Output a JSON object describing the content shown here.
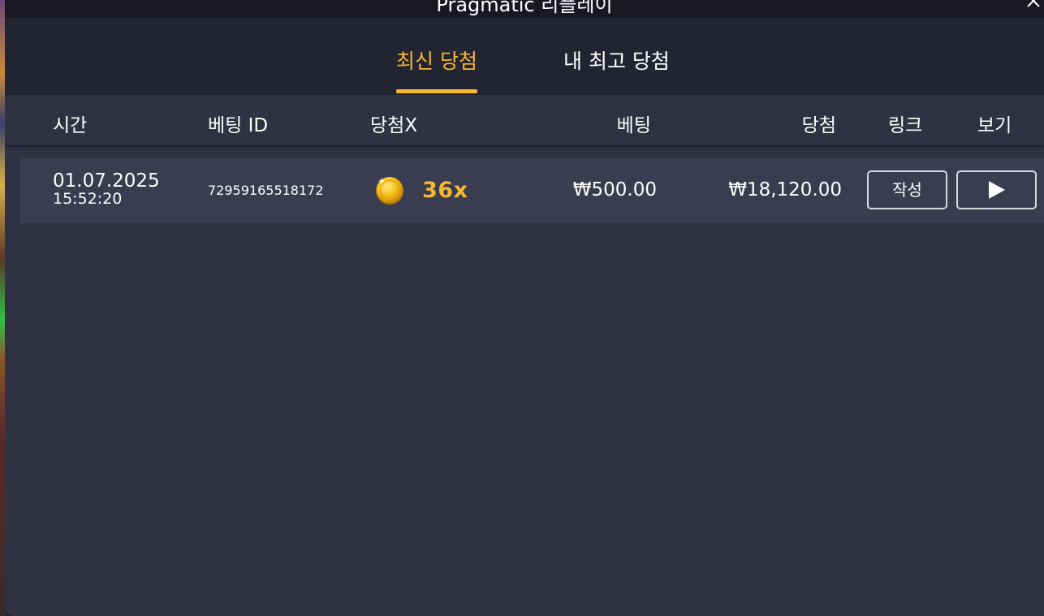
{
  "window": {
    "title": "Pragmatic 리플레이"
  },
  "tabs": [
    {
      "label": "최신 당첨",
      "active": true
    },
    {
      "label": "내 최고 당첨",
      "active": false
    }
  ],
  "columns": [
    "시간",
    "베팅 ID",
    "당첨X",
    "베팅",
    "당첨",
    "링크",
    "보기"
  ],
  "rows": [
    {
      "date": "01.07.2025",
      "time": "15:52:20",
      "bet_id": "72959165518172",
      "icon": "coin-icon",
      "multiplier": "36x",
      "bet": "₩500.00",
      "win": "₩18,120.00",
      "link_label": "작성",
      "view_icon": "play-icon"
    }
  ],
  "colors": {
    "accent": "#f5b730",
    "modal_bg": "#303142",
    "tab_bar": "#232432",
    "row_bg": "#3a3c4f"
  }
}
